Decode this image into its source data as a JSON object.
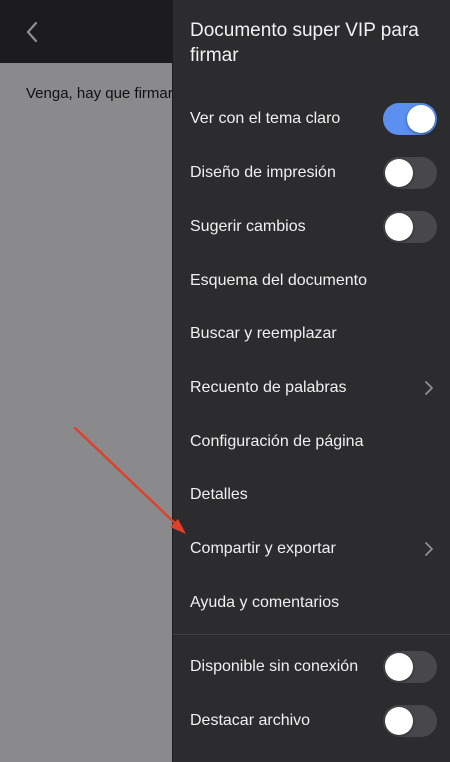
{
  "document": {
    "body_text": "Venga, hay que firmar esto"
  },
  "drawer": {
    "title": "Documento super VIP para firmar",
    "items": [
      {
        "label": "Ver con el tema claro",
        "control": "toggle",
        "on": true
      },
      {
        "label": "Diseño de impresión",
        "control": "toggle",
        "on": false
      },
      {
        "label": "Sugerir cambios",
        "control": "toggle",
        "on": false
      },
      {
        "label": "Esquema del documento",
        "control": "none"
      },
      {
        "label": "Buscar y reemplazar",
        "control": "none"
      },
      {
        "label": "Recuento de palabras",
        "control": "chevron"
      },
      {
        "label": "Configuración de página",
        "control": "none"
      },
      {
        "label": "Detalles",
        "control": "none"
      },
      {
        "label": "Compartir y exportar",
        "control": "chevron"
      },
      {
        "label": "Ayuda y comentarios",
        "control": "none"
      },
      {
        "label": "Disponible sin conexión",
        "control": "toggle",
        "on": false
      },
      {
        "label": "Destacar archivo",
        "control": "toggle",
        "on": false
      }
    ]
  },
  "colors": {
    "toggle_on": "#5b8ff0",
    "annotation_arrow": "#e0402a"
  }
}
